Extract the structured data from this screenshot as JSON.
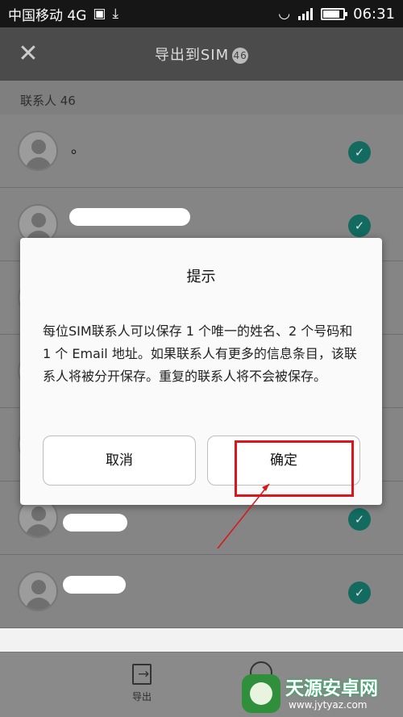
{
  "status_bar": {
    "carrier": "中国移动 4G",
    "time": "06:31",
    "battery_level": 0.85
  },
  "header": {
    "title": "导出到SIM",
    "count": "46"
  },
  "list": {
    "section_label": "联系人 46",
    "contacts": [
      {
        "name": "。",
        "selected": true
      },
      {
        "name": "",
        "selected": true
      },
      {
        "name": "",
        "selected": true
      },
      {
        "name": "",
        "selected": true
      },
      {
        "name": "",
        "selected": true
      },
      {
        "name": "",
        "selected": true
      },
      {
        "name": "",
        "selected": true
      },
      {
        "name": "",
        "selected": true
      }
    ]
  },
  "bottom_bar": {
    "export_label": "导出"
  },
  "dialog": {
    "title": "提示",
    "message": "每位SIM联系人可以保存 1 个唯一的姓名、2 个号码和 1 个 Email 地址。如果联系人有更多的信息条目，该联系人将被分开保存。重复的联系人将不会被保存。",
    "cancel_label": "取消",
    "ok_label": "确定"
  },
  "watermark": {
    "name": "天源安卓网",
    "url": "www.jytyaz.com"
  },
  "colors": {
    "accent_check": "#136a5f",
    "annotation": "#d8161b"
  }
}
